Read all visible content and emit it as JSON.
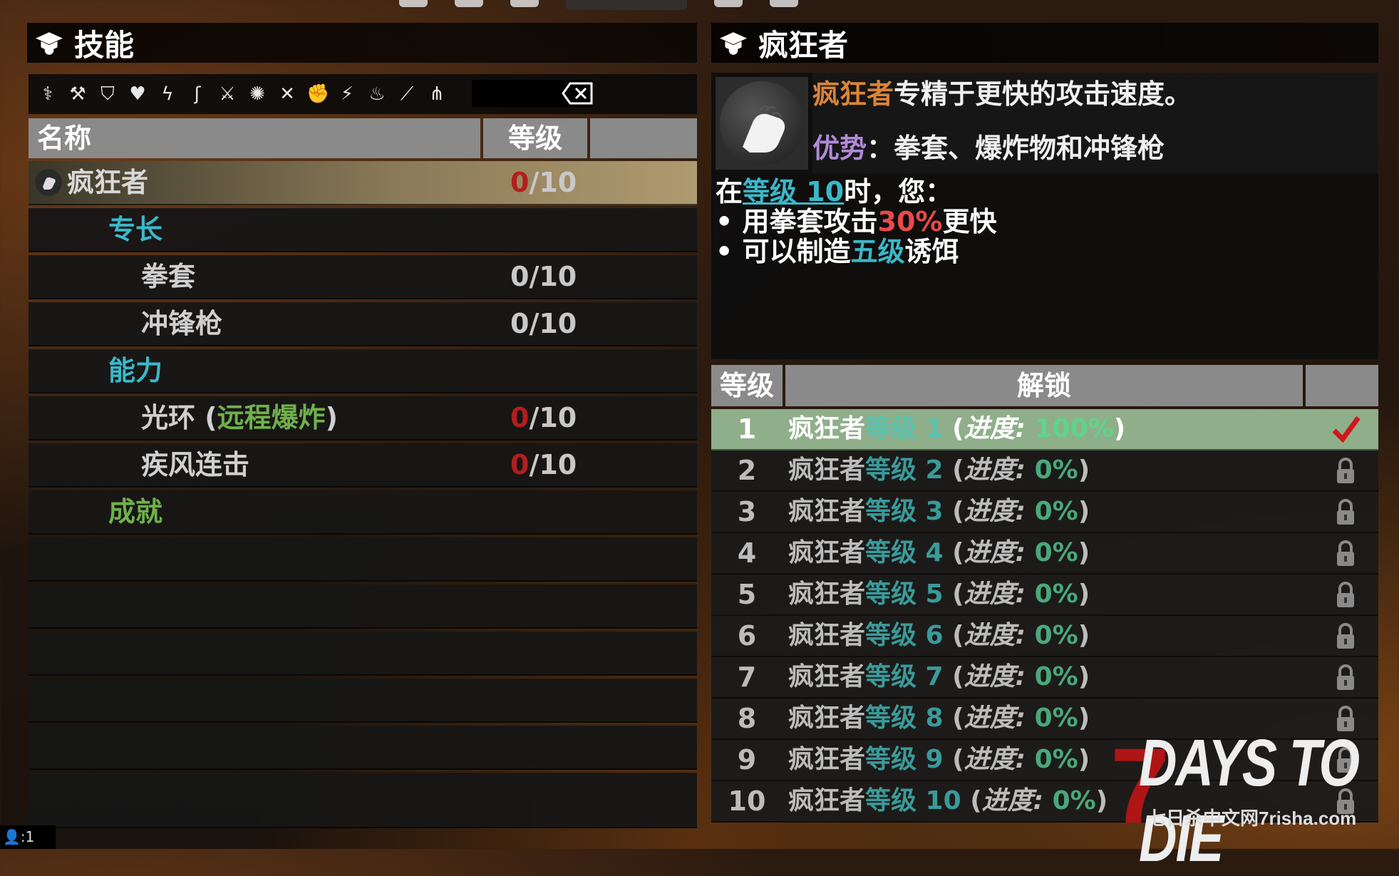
{
  "left": {
    "title": "技能",
    "columns": {
      "name": "名称",
      "level": "等级"
    },
    "selected": {
      "name": "疯狂者",
      "level_current": "0",
      "level_max": "/10"
    },
    "sections": [
      {
        "label": "专长"
      },
      {
        "label": "能力"
      },
      {
        "label": "成就"
      }
    ],
    "perks": [
      {
        "name": "拳套",
        "level": "0/10"
      },
      {
        "name": "冲锋枪",
        "level": "0/10"
      }
    ],
    "abilities": [
      {
        "name_prefix": "光环 (",
        "name_highlight": "远程爆炸",
        "name_suffix": ")",
        "level_current": "0",
        "level_max": "/10"
      },
      {
        "name": "疾风连击",
        "level_current": "0",
        "level_max": "/10"
      }
    ],
    "filter_icons": [
      "dna-icon",
      "hammer-icon",
      "shield-icon",
      "heart-shield-icon",
      "boots-icon",
      "tracker-icon",
      "cleaver-icon",
      "barbed-icon",
      "crossed-weapons-icon",
      "fist-icon",
      "stun-baton-icon",
      "flame-icon",
      "machete-icon",
      "spikes-icon"
    ]
  },
  "right": {
    "title": "疯狂者",
    "summary": {
      "name": "疯狂者",
      "text": "专精于更快的攻击速度。",
      "advantage_label": "优势",
      "advantage_text": "：拳套、爆炸物和冲锋枪"
    },
    "bonus": {
      "pre": "在",
      "link": "等级 10",
      "post": "时，您：",
      "line1_pre": "• 用拳套攻击",
      "line1_value": "30%",
      "line1_post": "更快",
      "line2_pre": "• 可以制造",
      "line2_value": "五级",
      "line2_post": "诱饵"
    },
    "unlock_columns": {
      "level": "等级",
      "unlock": "解锁"
    },
    "unlocks": [
      {
        "n": "1",
        "name": "疯狂者",
        "lvl": "等级 1",
        "progress_label": "进度:",
        "pct": "100%",
        "status": "done"
      },
      {
        "n": "2",
        "name": "疯狂者",
        "lvl": "等级 2",
        "progress_label": "进度:",
        "pct": "0%",
        "status": "locked"
      },
      {
        "n": "3",
        "name": "疯狂者",
        "lvl": "等级 3",
        "progress_label": "进度:",
        "pct": "0%",
        "status": "locked"
      },
      {
        "n": "4",
        "name": "疯狂者",
        "lvl": "等级 4",
        "progress_label": "进度:",
        "pct": "0%",
        "status": "locked"
      },
      {
        "n": "5",
        "name": "疯狂者",
        "lvl": "等级 5",
        "progress_label": "进度:",
        "pct": "0%",
        "status": "locked"
      },
      {
        "n": "6",
        "name": "疯狂者",
        "lvl": "等级 6",
        "progress_label": "进度:",
        "pct": "0%",
        "status": "locked"
      },
      {
        "n": "7",
        "name": "疯狂者",
        "lvl": "等级 7",
        "progress_label": "进度:",
        "pct": "0%",
        "status": "locked"
      },
      {
        "n": "8",
        "name": "疯狂者",
        "lvl": "等级 8",
        "progress_label": "进度:",
        "pct": "0%",
        "status": "locked"
      },
      {
        "n": "9",
        "name": "疯狂者",
        "lvl": "等级 9",
        "progress_label": "进度:",
        "pct": "0%",
        "status": "locked"
      },
      {
        "n": "10",
        "name": "疯狂者",
        "lvl": "等级 10",
        "progress_label": "进度:",
        "pct": "0%",
        "status": "locked"
      }
    ]
  },
  "logo": {
    "seven": "7",
    "main": "DAYS TO DIE",
    "sub": "七日杀中文网7risha.com"
  },
  "footer": {
    "player_count": "1"
  },
  "colors": {
    "red": "#b21e1e",
    "teal": "#3bb7c8",
    "orange": "#d9843a",
    "purple": "#b08ad8",
    "highlight_row": "#8fae8a"
  }
}
